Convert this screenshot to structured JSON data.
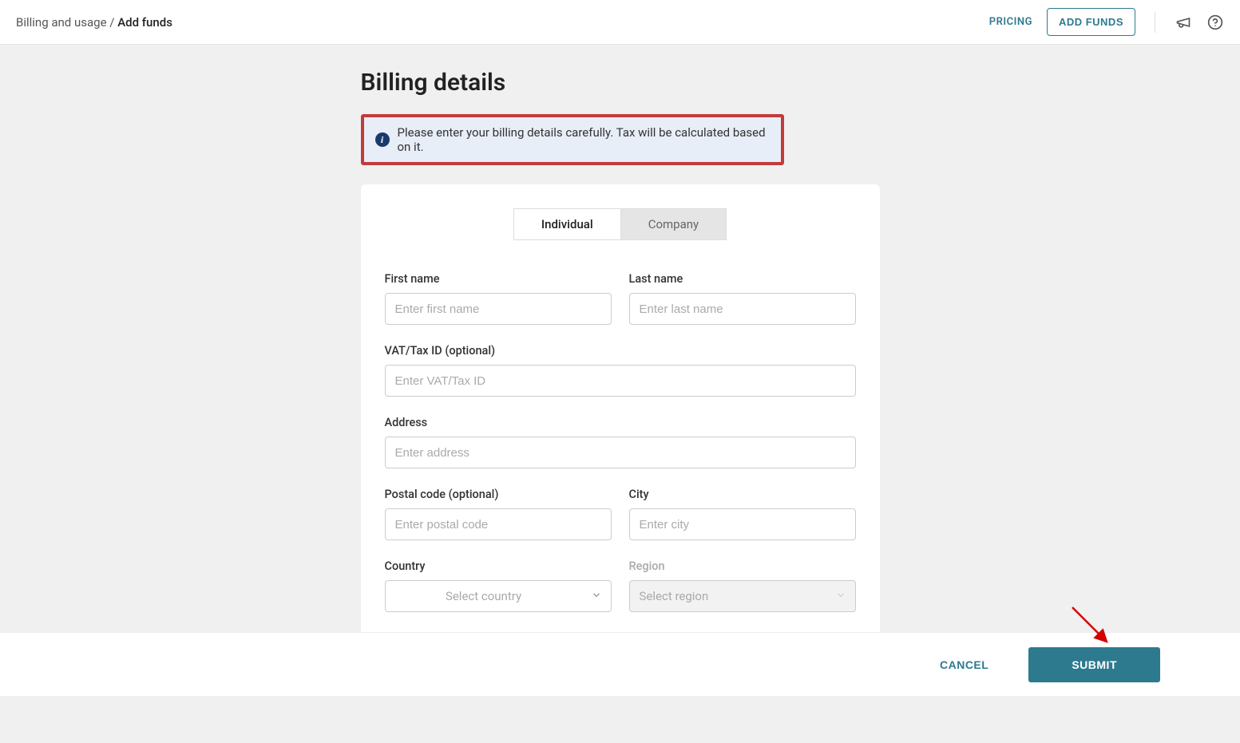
{
  "header": {
    "breadcrumb_parent": "Billing and usage",
    "breadcrumb_separator": " / ",
    "breadcrumb_current": "Add funds",
    "pricing_label": "PRICING",
    "add_funds_label": "ADD FUNDS"
  },
  "page": {
    "title": "Billing details",
    "info_message": "Please enter your billing details carefully. Tax will be calculated based on it."
  },
  "tabs": {
    "individual": "Individual",
    "company": "Company"
  },
  "form": {
    "first_name": {
      "label": "First name",
      "placeholder": "Enter first name"
    },
    "last_name": {
      "label": "Last name",
      "placeholder": "Enter last name"
    },
    "vat": {
      "label": "VAT/Tax ID (optional)",
      "placeholder": "Enter VAT/Tax ID"
    },
    "address": {
      "label": "Address",
      "placeholder": "Enter address"
    },
    "postal": {
      "label": "Postal code (optional)",
      "placeholder": "Enter postal code"
    },
    "city": {
      "label": "City",
      "placeholder": "Enter city"
    },
    "country": {
      "label": "Country",
      "placeholder": "Select country"
    },
    "region": {
      "label": "Region",
      "placeholder": "Select region"
    }
  },
  "footer": {
    "cancel": "CANCEL",
    "submit": "SUBMIT"
  }
}
